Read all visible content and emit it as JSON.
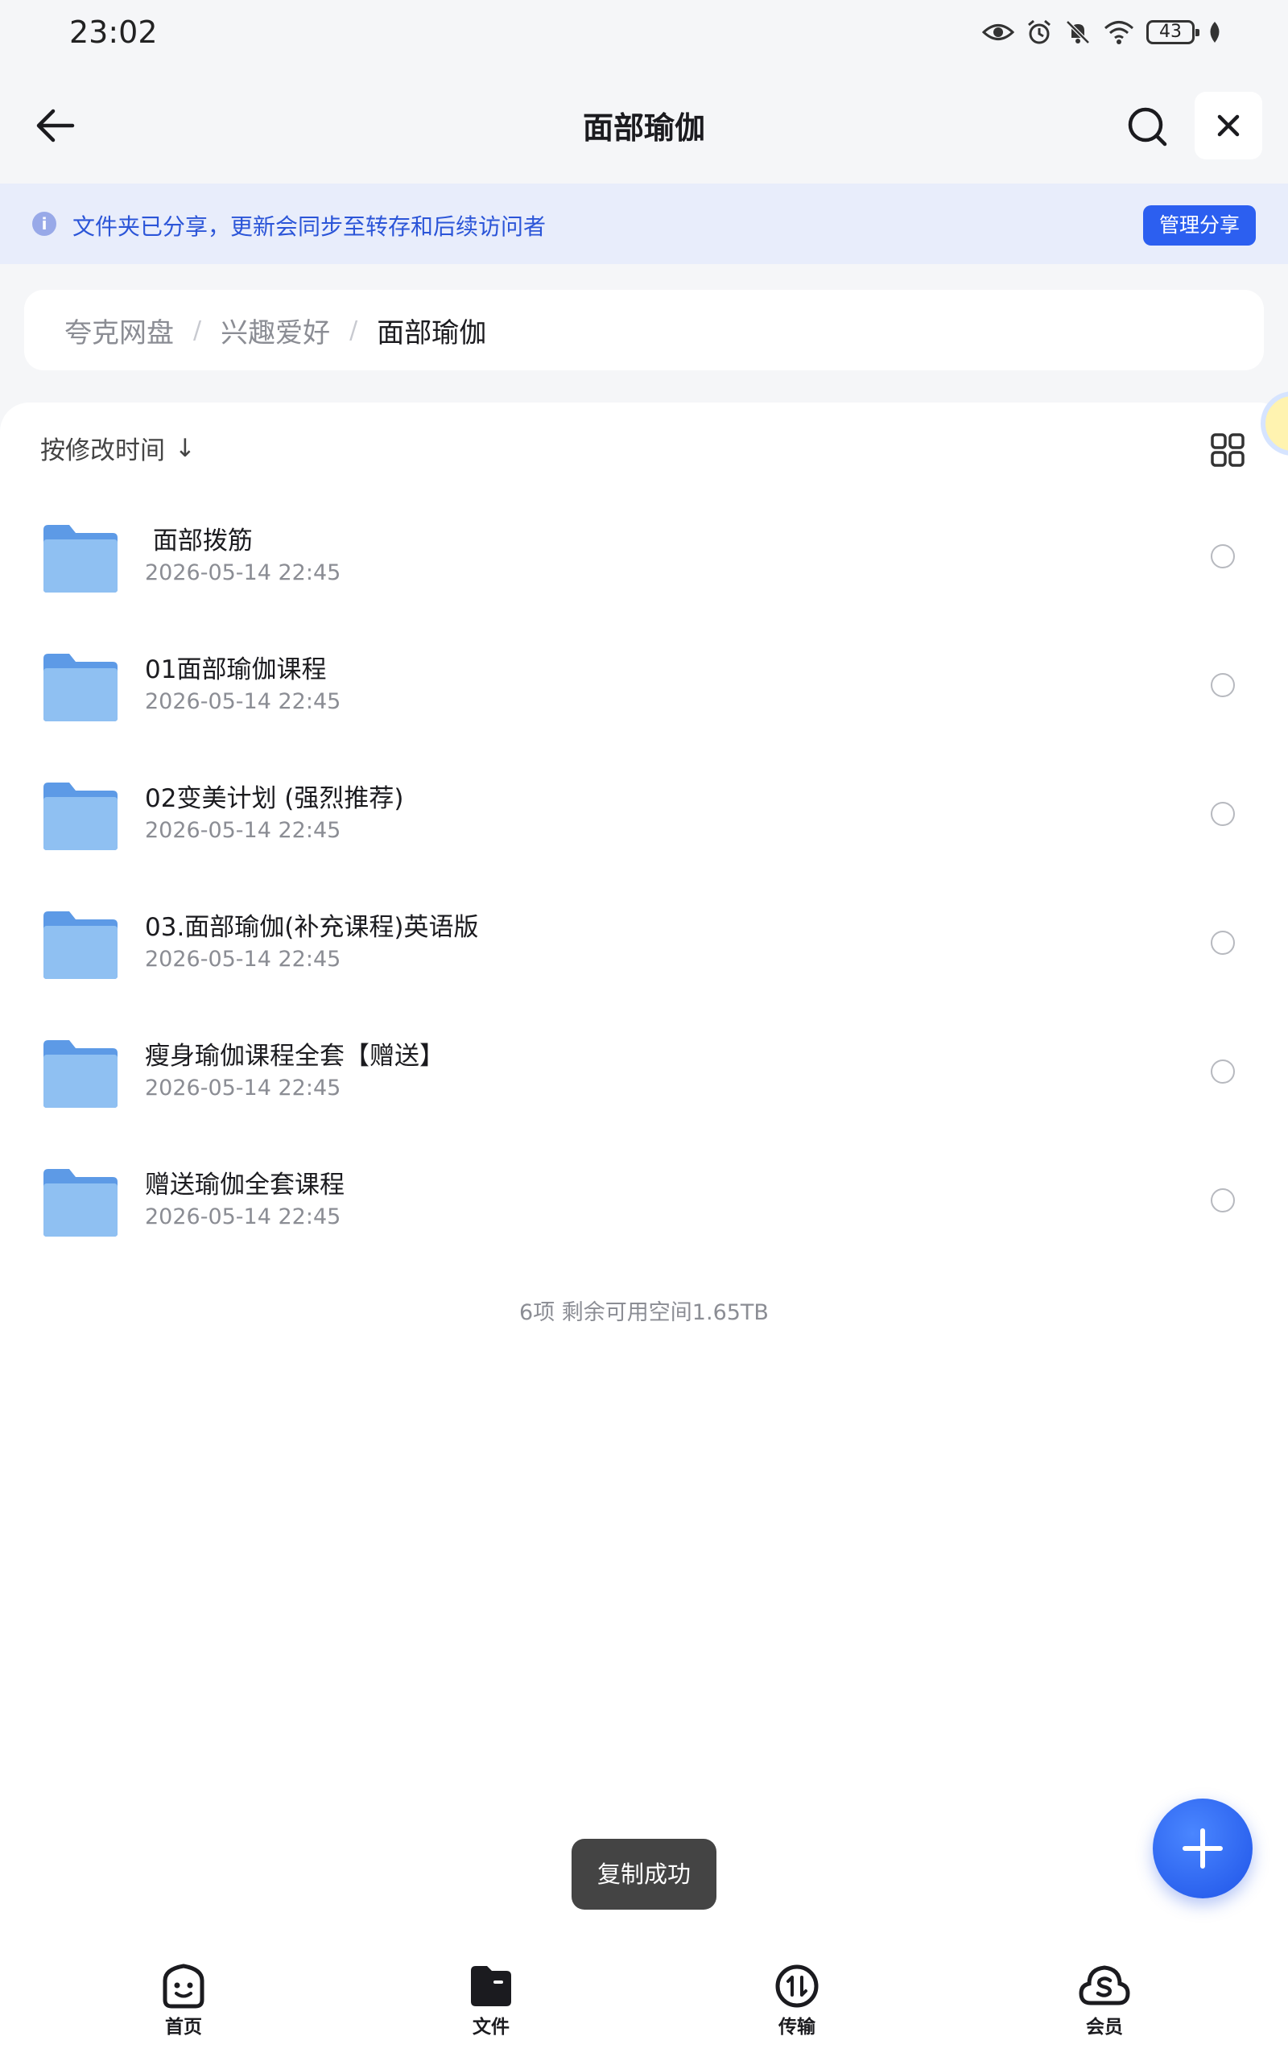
{
  "status_bar": {
    "time": "23:02",
    "battery": "43",
    "icons": [
      "eye-icon",
      "alarm-icon",
      "bell-muted-icon",
      "wifi-icon",
      "battery-icon",
      "leaf-icon"
    ]
  },
  "header": {
    "title": "面部瑜伽",
    "back_icon": "arrow-left-icon",
    "search_icon": "search-icon",
    "close_icon": "close-icon"
  },
  "share_banner": {
    "text": "文件夹已分享，更新会同步至转存和后续访问者",
    "button_label": "管理分享",
    "info_glyph": "i"
  },
  "breadcrumb": {
    "items": [
      "夸克网盘",
      "兴趣爱好",
      "面部瑜伽"
    ],
    "separator": "/"
  },
  "list_header": {
    "sort_label": "按修改时间",
    "sort_arrow": "↓"
  },
  "files": [
    {
      "name": " 面部拨筋",
      "date": "2026-05-14 22:45"
    },
    {
      "name": "01面部瑜伽课程",
      "date": "2026-05-14 22:45"
    },
    {
      "name": "02变美计划 (强烈推荐)",
      "date": "2026-05-14 22:45"
    },
    {
      "name": "03.面部瑜伽(补充课程)英语版",
      "date": "2026-05-14 22:45"
    },
    {
      "name": "瘦身瑜伽课程全套【赠送】",
      "date": "2026-05-14 22:45"
    },
    {
      "name": "赠送瑜伽全套课程",
      "date": "2026-05-14 22:45"
    }
  ],
  "summary": "6项 剩余可用空间1.65TB",
  "toast": "复制成功",
  "bottom_nav": [
    {
      "label": "首页",
      "icon": "home-face-icon"
    },
    {
      "label": "文件",
      "icon": "folder-icon"
    },
    {
      "label": "传输",
      "icon": "transfer-icon"
    },
    {
      "label": "会员",
      "icon": "member-cloud-icon"
    }
  ],
  "colors": {
    "accent": "#2c5ff0",
    "banner_bg": "#e8edfb",
    "folder": "#7fb3ee"
  }
}
